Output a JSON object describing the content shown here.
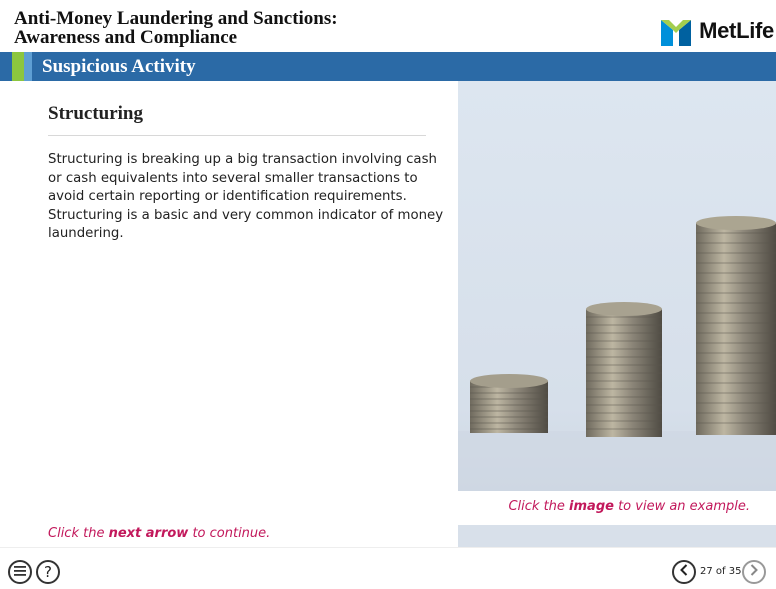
{
  "header": {
    "course_title_line1": "Anti-Money Laundering and Sanctions:",
    "course_title_line2": "Awareness and Compliance",
    "logo_text": "MetLife",
    "logo_icon": "metlife-m-icon"
  },
  "section": {
    "title": "Suspicious Activity"
  },
  "slide": {
    "heading": "Structuring",
    "body": "Structuring is breaking up a big transaction involving cash or cash equivalents into several smaller transactions to avoid certain reporting or identification requirements. Structuring is a basic and very common indicator of money laundering.",
    "continue_hint": {
      "prefix": "Click the ",
      "emphasis": "next arrow",
      "suffix": " to continue."
    }
  },
  "image_panel": {
    "caption": {
      "prefix": "Click the ",
      "emphasis": "image",
      "suffix": " to view an example."
    }
  },
  "footer": {
    "menu_icon": "menu-icon",
    "help_icon": "help-icon",
    "help_glyph": "?",
    "prev_icon": "chevron-left-icon",
    "next_icon": "chevron-right-icon",
    "page_counter": "27 of 35"
  },
  "colors": {
    "section_bar": "#2b6aa6",
    "accent_green": "#8cc63f",
    "accent_light_blue": "#5e9fd4",
    "hint_magenta": "#c2185b"
  }
}
